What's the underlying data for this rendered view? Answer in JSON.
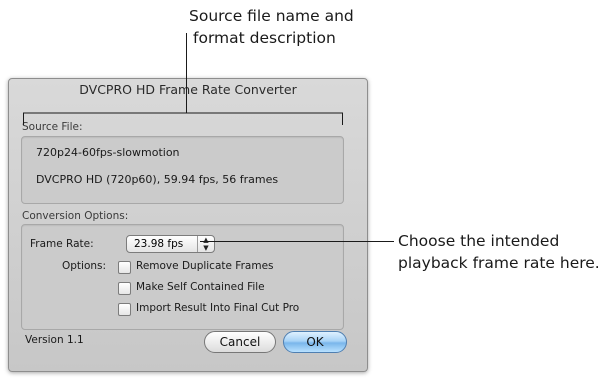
{
  "callouts": {
    "source_line1": "Source file name and",
    "source_line2": "format description",
    "framerate_line1": "Choose the intended",
    "framerate_line2": "playback frame rate here."
  },
  "dialog": {
    "title": "DVCPRO HD Frame Rate Converter",
    "source_label": "Source File:",
    "source_name": "720p24-60fps-slowmotion",
    "source_format": "DVCPRO HD (720p60), 59.94 fps, 56 frames",
    "conversion_label": "Conversion Options:",
    "frame_rate_label": "Frame Rate:",
    "frame_rate_value": "23.98 fps",
    "options_label": "Options:",
    "options": [
      {
        "label": "Remove Duplicate Frames",
        "checked": false
      },
      {
        "label": "Make Self Contained File",
        "checked": false
      },
      {
        "label": "Import Result Into Final Cut Pro",
        "checked": false
      }
    ],
    "version": "Version 1.1",
    "cancel_label": "Cancel",
    "ok_label": "OK"
  },
  "colors": {
    "dialog_bg": "#d3d3d3",
    "ok_button": "#8cc2f0",
    "callout_text": "#1a1a1a"
  },
  "icons": {
    "popup_arrows": "up-down-arrows-icon"
  }
}
